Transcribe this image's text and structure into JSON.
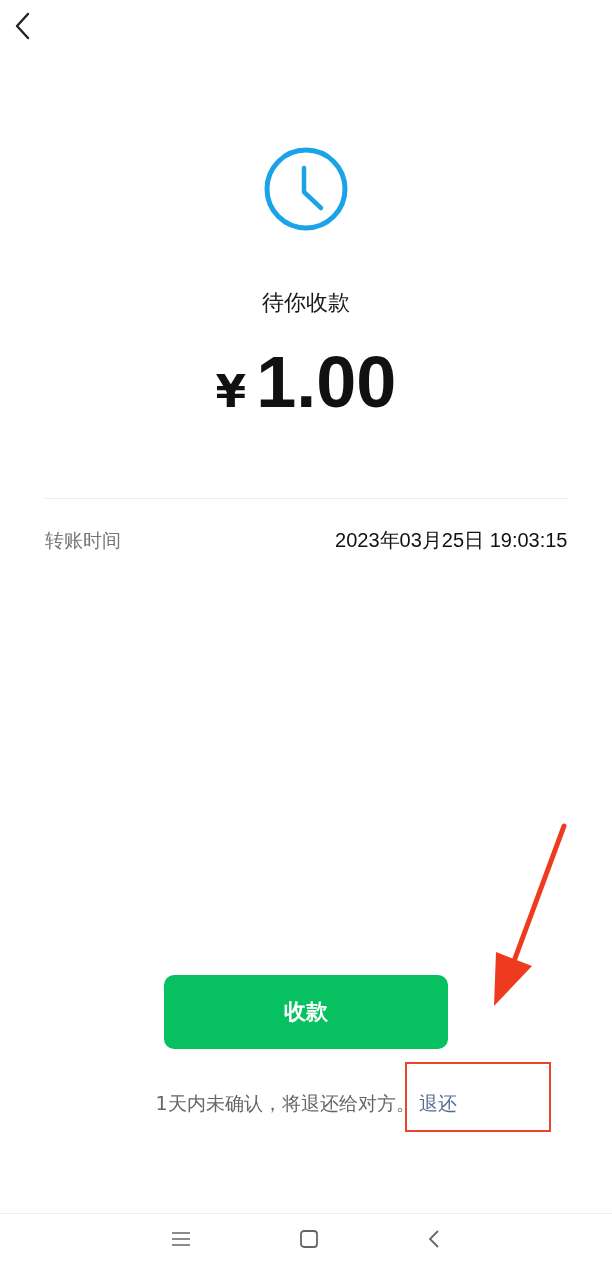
{
  "status": {
    "title": "待你收款"
  },
  "amount": {
    "currency": "¥",
    "value": "1.00"
  },
  "details": [
    {
      "label": "转账时间",
      "value": "2023年03月25日 19:03:15"
    }
  ],
  "accept_button": {
    "label": "收款"
  },
  "note": {
    "text": "1天内未确认，将退还给对方。",
    "link": "退还"
  }
}
